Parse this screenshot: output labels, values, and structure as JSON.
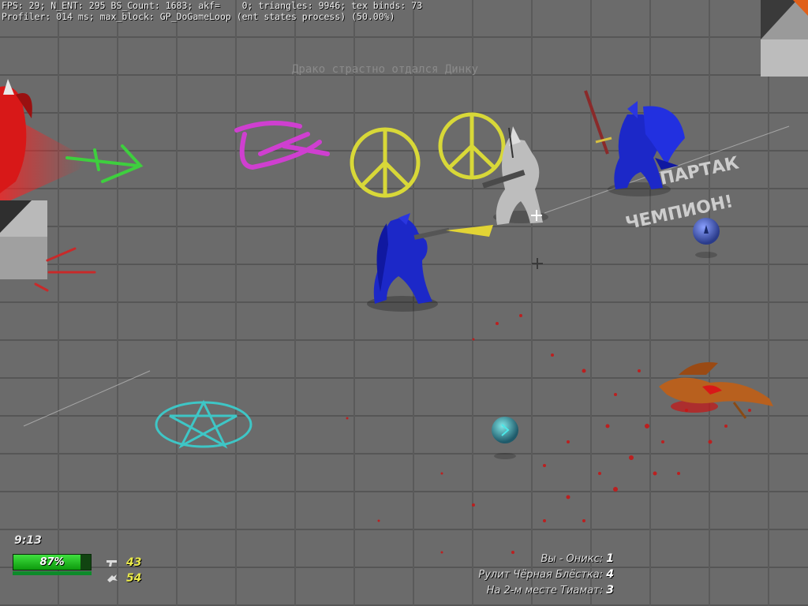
{
  "debug": {
    "line1": "FPS: 29; N_ENT: 295 BS_Count: 1683; akf=    0; triangles: 9946; tex binds: 73",
    "line2": "Profiler: 014 ms; max_block: GP_DoGameLoop (ent states process) (50.00%)"
  },
  "kill_message": "Драко страстно отдался Динку",
  "graffiti_text": [
    "СПАРТАК",
    "ЧЕМПИОН!"
  ],
  "hud": {
    "timer": "9:13",
    "health_label": "87%",
    "health_fraction": 0.87,
    "ammo_primary": "43",
    "ammo_secondary": "54"
  },
  "scoreboard": {
    "line1_label": "Вы - Оникс:",
    "line1_value": "1",
    "line2_label": "Рулит Чёрная Блёстка:",
    "line2_value": "4",
    "line3_label": "На 2-м месте Тиамат:",
    "line3_value": "3"
  },
  "colors": {
    "floor": "#6a6a6a",
    "grout": "#5a5a5a",
    "health": "#2fcf2f",
    "ammo": "#e8e84a",
    "blood": "#c81414"
  },
  "icons": [
    "pistol-icon",
    "grenade-icon",
    "crosshair-icon",
    "powerup-orb-icon"
  ]
}
